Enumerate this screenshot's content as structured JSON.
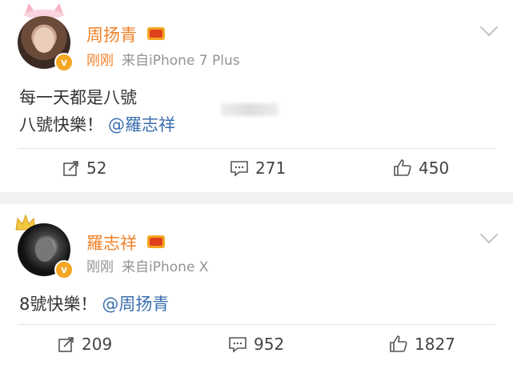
{
  "posts": [
    {
      "name": "周扬青",
      "time": "刚刚",
      "source": "来自iPhone 7 Plus",
      "text_line1": "每一天都是八號",
      "text_line2": "八號快樂！",
      "mention": "@羅志祥",
      "repost_count": "52",
      "comment_count": "271",
      "like_count": "450"
    },
    {
      "name": "羅志祥",
      "time": "刚刚",
      "source": "来自iPhone X",
      "text_line1": "8號快樂！",
      "mention": "@周扬青",
      "repost_count": "209",
      "comment_count": "952",
      "like_count": "1827"
    }
  ],
  "colors": {
    "name": "#f0822a",
    "mention": "#3a6fb0",
    "meta": "#939393"
  },
  "icons": [
    "repost-icon",
    "comment-icon",
    "like-icon",
    "chevron-down-icon",
    "verified-icon",
    "vip-crown-icon"
  ]
}
